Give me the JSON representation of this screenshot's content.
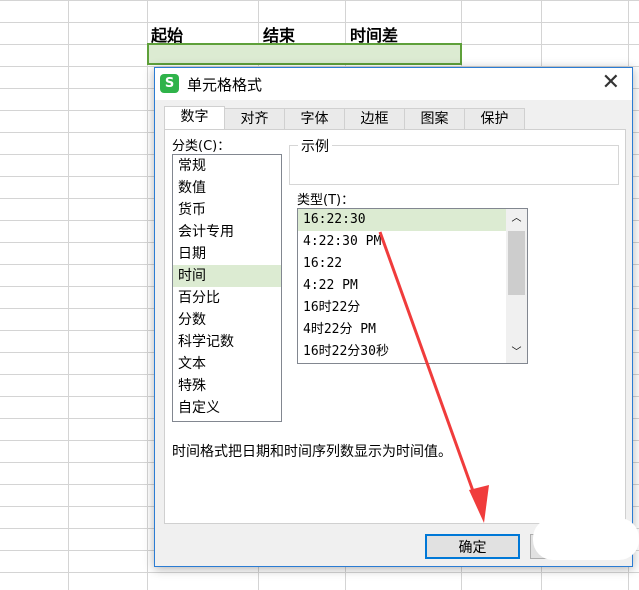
{
  "sheet": {
    "headers": [
      "起始",
      "结束",
      "时间差"
    ]
  },
  "dialog": {
    "title": "单元格格式",
    "tabs": [
      "数字",
      "对齐",
      "字体",
      "边框",
      "图案",
      "保护"
    ],
    "category_label": "分类(C)：",
    "categories": [
      "常规",
      "数值",
      "货币",
      "会计专用",
      "日期",
      "时间",
      "百分比",
      "分数",
      "科学记数",
      "文本",
      "特殊",
      "自定义"
    ],
    "selected_category": "时间",
    "sample_label": "示例",
    "type_label": "类型(T)：",
    "types": [
      "16:22:30",
      "4:22:30 PM",
      "16:22",
      "4:22 PM",
      "16时22分",
      "4时22分 PM",
      "16时22分30秒"
    ],
    "description": "时间格式把日期和时间序列数显示为时间值。",
    "ok_label": "确定"
  },
  "colors": {
    "accent": "#2b7cd3",
    "selection": "#dcebd2",
    "arrow": "#f03c3c"
  }
}
